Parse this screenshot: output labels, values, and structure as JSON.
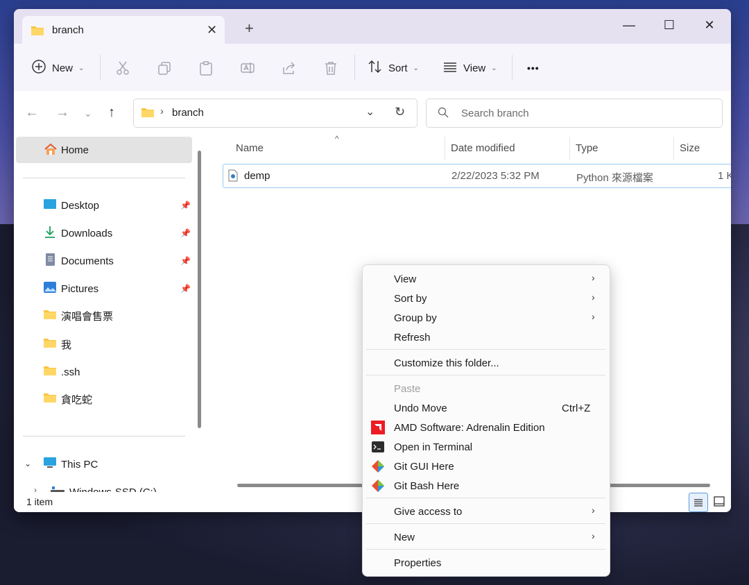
{
  "window": {
    "tab_title": "branch",
    "tab_close": "✕",
    "new_tab": "+",
    "minimize": "—",
    "maximize": "☐",
    "close": "✕"
  },
  "toolbar": {
    "new_label": "New",
    "sort_label": "Sort",
    "view_label": "View",
    "more_label": "•••"
  },
  "address": {
    "crumb": "branch",
    "search_placeholder": "Search branch"
  },
  "sidebar": {
    "home": "Home",
    "items": [
      {
        "label": "Desktop",
        "icon": "desktop-icon",
        "pinned": true
      },
      {
        "label": "Downloads",
        "icon": "download-icon",
        "pinned": true
      },
      {
        "label": "Documents",
        "icon": "document-icon",
        "pinned": true
      },
      {
        "label": "Pictures",
        "icon": "pictures-icon",
        "pinned": true
      },
      {
        "label": "演唱會售票",
        "icon": "folder-icon",
        "pinned": false
      },
      {
        "label": "我",
        "icon": "folder-icon",
        "pinned": false
      },
      {
        "label": ".ssh",
        "icon": "folder-icon",
        "pinned": false
      },
      {
        "label": "貪吃蛇",
        "icon": "folder-icon",
        "pinned": false
      }
    ],
    "this_pc": "This PC",
    "drive": "Windows-SSD (C:)"
  },
  "columns": {
    "name": "Name",
    "date": "Date modified",
    "type": "Type",
    "size": "Size"
  },
  "file": {
    "name": "demp",
    "date": "2/22/2023 5:32 PM",
    "type": "Python 來源檔案",
    "size": "1 K"
  },
  "status": {
    "count": "1 item"
  },
  "context_menu": {
    "view": "View",
    "sort_by": "Sort by",
    "group_by": "Group by",
    "refresh": "Refresh",
    "customize": "Customize this folder...",
    "paste": "Paste",
    "undo_move": "Undo Move",
    "undo_shortcut": "Ctrl+Z",
    "amd": "AMD Software: Adrenalin Edition",
    "terminal": "Open in Terminal",
    "git_gui": "Git GUI Here",
    "git_bash": "Git Bash Here",
    "give_access": "Give access to",
    "new": "New",
    "properties": "Properties"
  },
  "colors": {
    "accent": "#0067c0",
    "folder": "#f8c542",
    "selected_row_border": "#99c9ef",
    "amd_red": "#ed1c24"
  }
}
